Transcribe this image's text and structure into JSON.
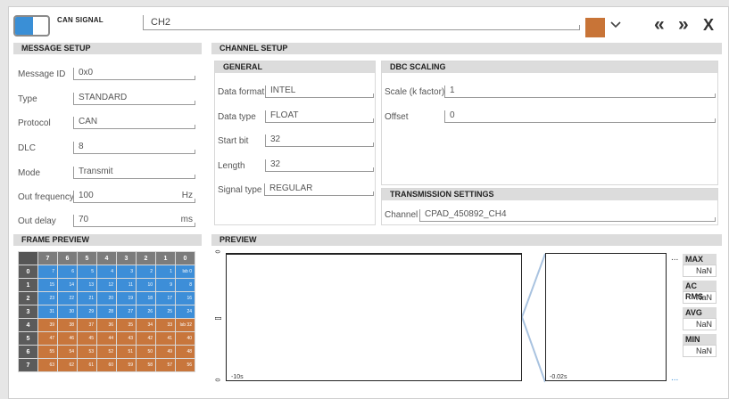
{
  "header": {
    "app_label": "CAN SIGNAL",
    "channel_name": "CH2",
    "accent_color": "#c87437",
    "controls": {
      "prev": "«",
      "next": "»",
      "close": "X"
    }
  },
  "message_setup": {
    "title": "MESSAGE SETUP",
    "fields": [
      {
        "label": "Message ID",
        "value": "0x0",
        "unit": ""
      },
      {
        "label": "Type",
        "value": "STANDARD",
        "unit": ""
      },
      {
        "label": "Protocol",
        "value": "CAN",
        "unit": ""
      },
      {
        "label": "DLC",
        "value": "8",
        "unit": ""
      },
      {
        "label": "Mode",
        "value": "Transmit",
        "unit": ""
      },
      {
        "label": "Out frequency",
        "value": "100",
        "unit": "Hz"
      },
      {
        "label": "Out delay",
        "value": "70",
        "unit": "ms"
      }
    ]
  },
  "channel_setup": {
    "title": "CHANNEL SETUP",
    "general": {
      "title": "GENERAL",
      "fields": [
        {
          "label": "Data format",
          "value": "INTEL"
        },
        {
          "label": "Data type",
          "value": "FLOAT"
        },
        {
          "label": "Start bit",
          "value": "32"
        },
        {
          "label": "Length",
          "value": "32"
        },
        {
          "label": "Signal type",
          "value": "REGULAR"
        }
      ]
    },
    "dbc_scaling": {
      "title": "DBC SCALING",
      "fields": [
        {
          "label": "Scale (k factor)",
          "value": "1"
        },
        {
          "label": "Offset",
          "value": "0"
        }
      ]
    },
    "transmission": {
      "title": "TRANSMISSION SETTINGS",
      "channel_label": "Channel",
      "channel_value": "CPAD_450892_CH4"
    }
  },
  "frame_preview": {
    "title": "FRAME PREVIEW",
    "bit_headers": [
      "7",
      "6",
      "5",
      "4",
      "3",
      "2",
      "1",
      "0"
    ],
    "rows": [
      {
        "byte": "0",
        "cells": [
          "7",
          "6",
          "5",
          "4",
          "3",
          "2",
          "1",
          "lsb 0"
        ],
        "color": "blue"
      },
      {
        "byte": "1",
        "cells": [
          "15",
          "14",
          "13",
          "12",
          "11",
          "10",
          "9",
          "8"
        ],
        "color": "blue"
      },
      {
        "byte": "2",
        "cells": [
          "23",
          "22",
          "21",
          "20",
          "19",
          "18",
          "17",
          "16"
        ],
        "color": "blue"
      },
      {
        "byte": "3",
        "cells": [
          "31",
          "30",
          "29",
          "28",
          "27",
          "26",
          "25",
          "24"
        ],
        "color": "blue"
      },
      {
        "byte": "4",
        "cells": [
          "39",
          "38",
          "37",
          "36",
          "35",
          "34",
          "33",
          "lsb 32"
        ],
        "color": "orange"
      },
      {
        "byte": "5",
        "cells": [
          "47",
          "46",
          "45",
          "44",
          "43",
          "42",
          "41",
          "40"
        ],
        "color": "orange"
      },
      {
        "byte": "6",
        "cells": [
          "55",
          "54",
          "53",
          "52",
          "51",
          "50",
          "49",
          "48"
        ],
        "color": "orange"
      },
      {
        "byte": "7",
        "cells": [
          "63",
          "62",
          "61",
          "60",
          "59",
          "58",
          "57",
          "56"
        ],
        "color": "orange"
      }
    ]
  },
  "preview": {
    "title": "PREVIEW",
    "y_top": "0",
    "y_bottom": "0",
    "y_unit": "[]",
    "x_start_main": "-10s",
    "x_start_zoom": "-0.02s",
    "ellipsis_top": "...",
    "ellipsis_bottom": "...",
    "stats": [
      {
        "label": "MAX",
        "value": "NaN"
      },
      {
        "label": "AC RMS",
        "value": "NaN"
      },
      {
        "label": "AVG",
        "value": "NaN"
      },
      {
        "label": "MIN",
        "value": "NaN"
      }
    ]
  }
}
